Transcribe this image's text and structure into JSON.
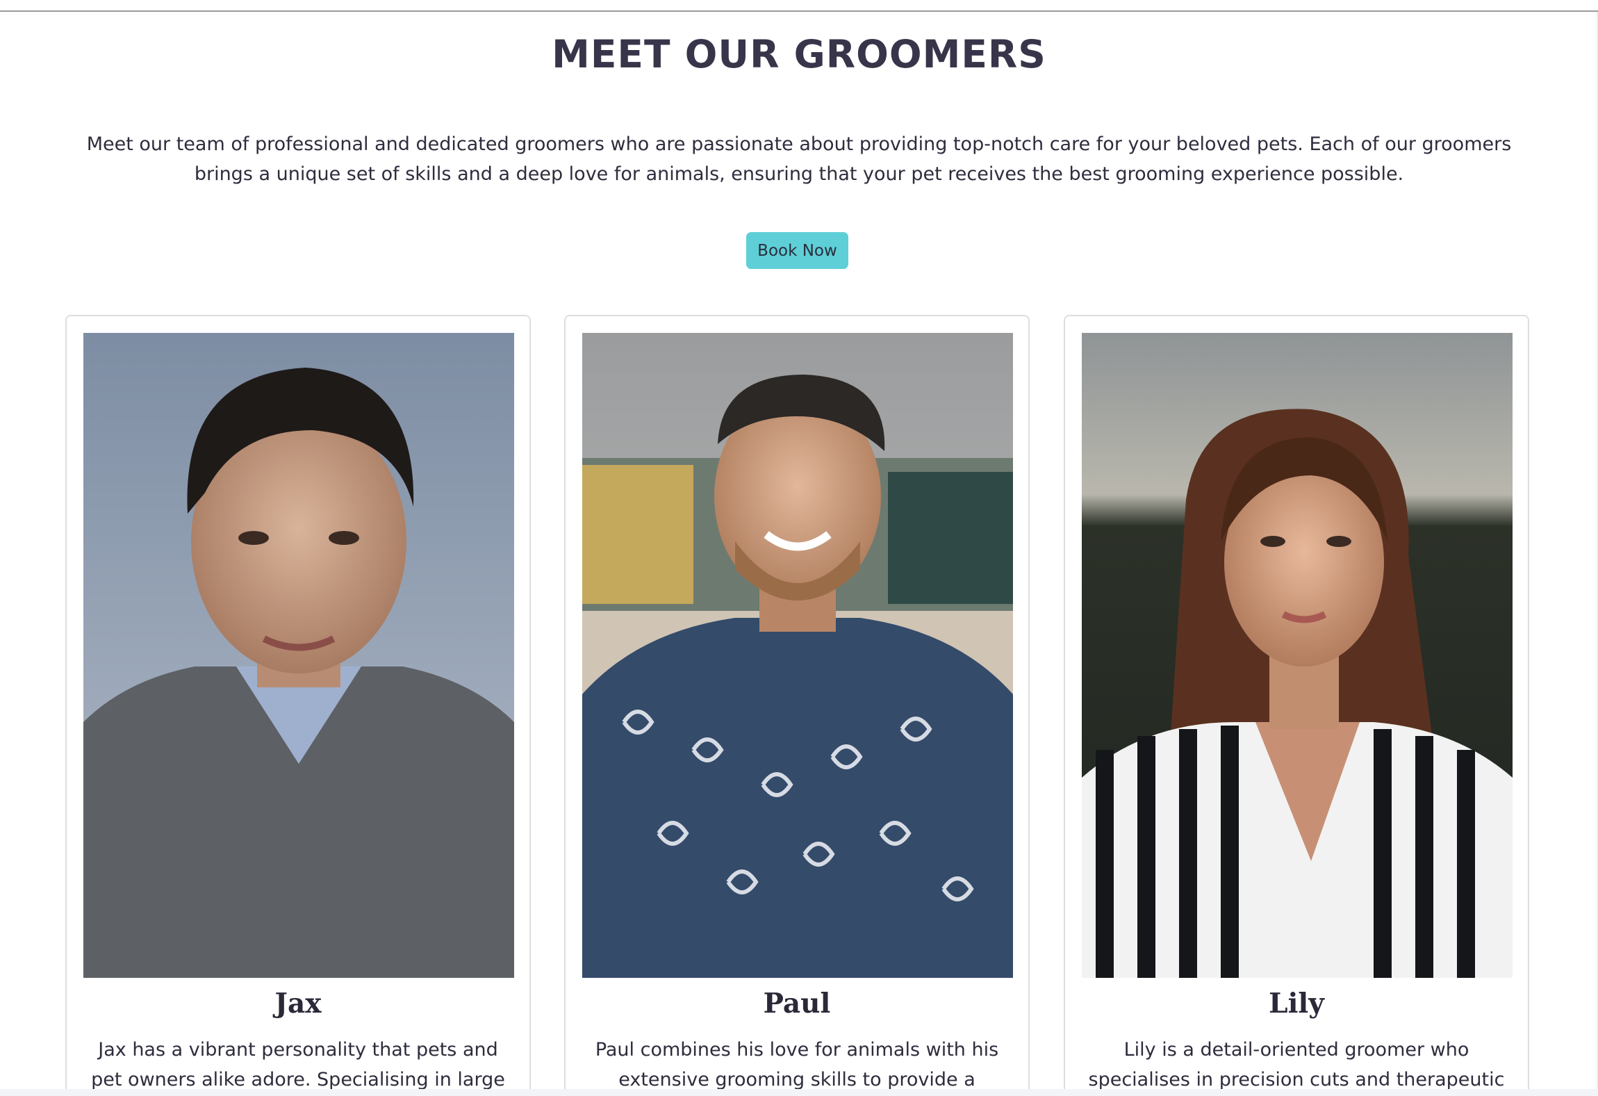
{
  "section": {
    "heading": "MEET OUR GROOMERS",
    "intro": "Meet our team of professional and dedicated groomers who are passionate about providing top-notch care for your beloved pets. Each of our groomers brings a unique set of skills and a deep love for animals, ensuring that your pet receives the best grooming experience possible.",
    "cta_label": "Book Now"
  },
  "groomers": [
    {
      "name": "Jax",
      "bio": "Jax has a vibrant personality that pets and pet owners alike adore. Specialising in large breeds,"
    },
    {
      "name": "Paul",
      "bio": "Paul combines his love for animals with his extensive grooming skills to provide a"
    },
    {
      "name": "Lily",
      "bio": "Lily is a detail-oriented groomer who specialises in precision cuts and therapeutic grooming. Her"
    }
  ],
  "colors": {
    "accent": "#5ecfd7",
    "heading": "#38344a",
    "text": "#2f2c3d",
    "card_border": "#dedede"
  }
}
